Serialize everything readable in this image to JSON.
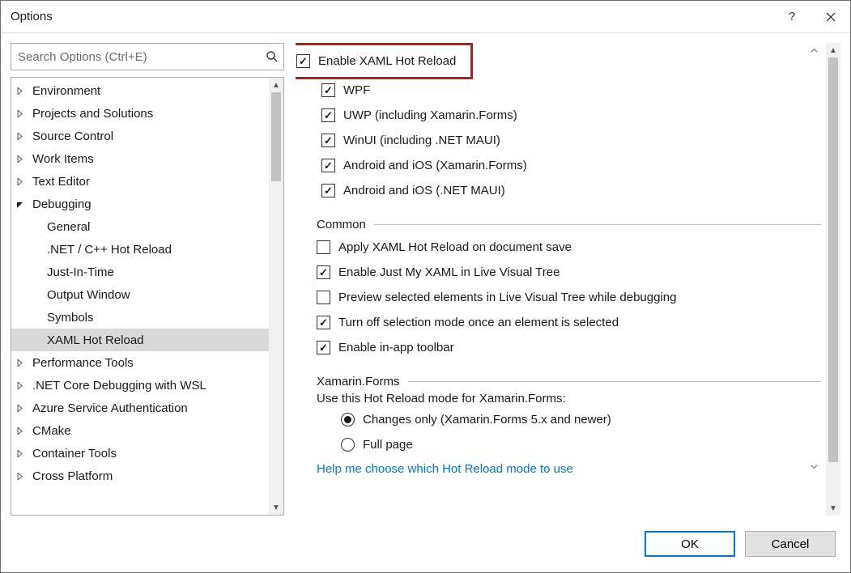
{
  "window": {
    "title": "Options"
  },
  "search": {
    "placeholder": "Search Options (Ctrl+E)"
  },
  "tree": {
    "items": [
      {
        "label": "Environment",
        "expanded": false,
        "level": 0
      },
      {
        "label": "Projects and Solutions",
        "expanded": false,
        "level": 0
      },
      {
        "label": "Source Control",
        "expanded": false,
        "level": 0
      },
      {
        "label": "Work Items",
        "expanded": false,
        "level": 0
      },
      {
        "label": "Text Editor",
        "expanded": false,
        "level": 0
      },
      {
        "label": "Debugging",
        "expanded": true,
        "level": 0
      },
      {
        "label": "General",
        "level": 1
      },
      {
        "label": ".NET / C++ Hot Reload",
        "level": 1
      },
      {
        "label": "Just-In-Time",
        "level": 1
      },
      {
        "label": "Output Window",
        "level": 1
      },
      {
        "label": "Symbols",
        "level": 1
      },
      {
        "label": "XAML Hot Reload",
        "level": 1,
        "selected": true
      },
      {
        "label": "Performance Tools",
        "expanded": false,
        "level": 0
      },
      {
        "label": ".NET Core Debugging with WSL",
        "expanded": false,
        "level": 0
      },
      {
        "label": "Azure Service Authentication",
        "expanded": false,
        "level": 0
      },
      {
        "label": "CMake",
        "expanded": false,
        "level": 0
      },
      {
        "label": "Container Tools",
        "expanded": false,
        "level": 0
      },
      {
        "label": "Cross Platform",
        "expanded": false,
        "level": 0
      }
    ]
  },
  "main": {
    "enable": {
      "label": "Enable XAML Hot Reload",
      "checked": true
    },
    "platforms": [
      {
        "label": "WPF",
        "checked": true
      },
      {
        "label": "UWP (including Xamarin.Forms)",
        "checked": true
      },
      {
        "label": "WinUI (including .NET MAUI)",
        "checked": true
      },
      {
        "label": "Android and iOS (Xamarin.Forms)",
        "checked": true
      },
      {
        "label": "Android and iOS (.NET MAUI)",
        "checked": true
      }
    ],
    "common": {
      "header": "Common",
      "items": [
        {
          "label": "Apply XAML Hot Reload on document save",
          "checked": false
        },
        {
          "label": "Enable Just My XAML in Live Visual Tree",
          "checked": true
        },
        {
          "label": "Preview selected elements in Live Visual Tree while debugging",
          "checked": false
        },
        {
          "label": "Turn off selection mode once an element is selected",
          "checked": true
        },
        {
          "label": "Enable in-app toolbar",
          "checked": true
        }
      ]
    },
    "xamarin": {
      "header": "Xamarin.Forms",
      "prompt": "Use this Hot Reload mode for Xamarin.Forms:",
      "options": [
        {
          "label": "Changes only (Xamarin.Forms 5.x and newer)",
          "checked": true
        },
        {
          "label": "Full page",
          "checked": false
        }
      ],
      "help": "Help me choose which Hot Reload mode to use"
    }
  },
  "footer": {
    "ok": "OK",
    "cancel": "Cancel"
  }
}
